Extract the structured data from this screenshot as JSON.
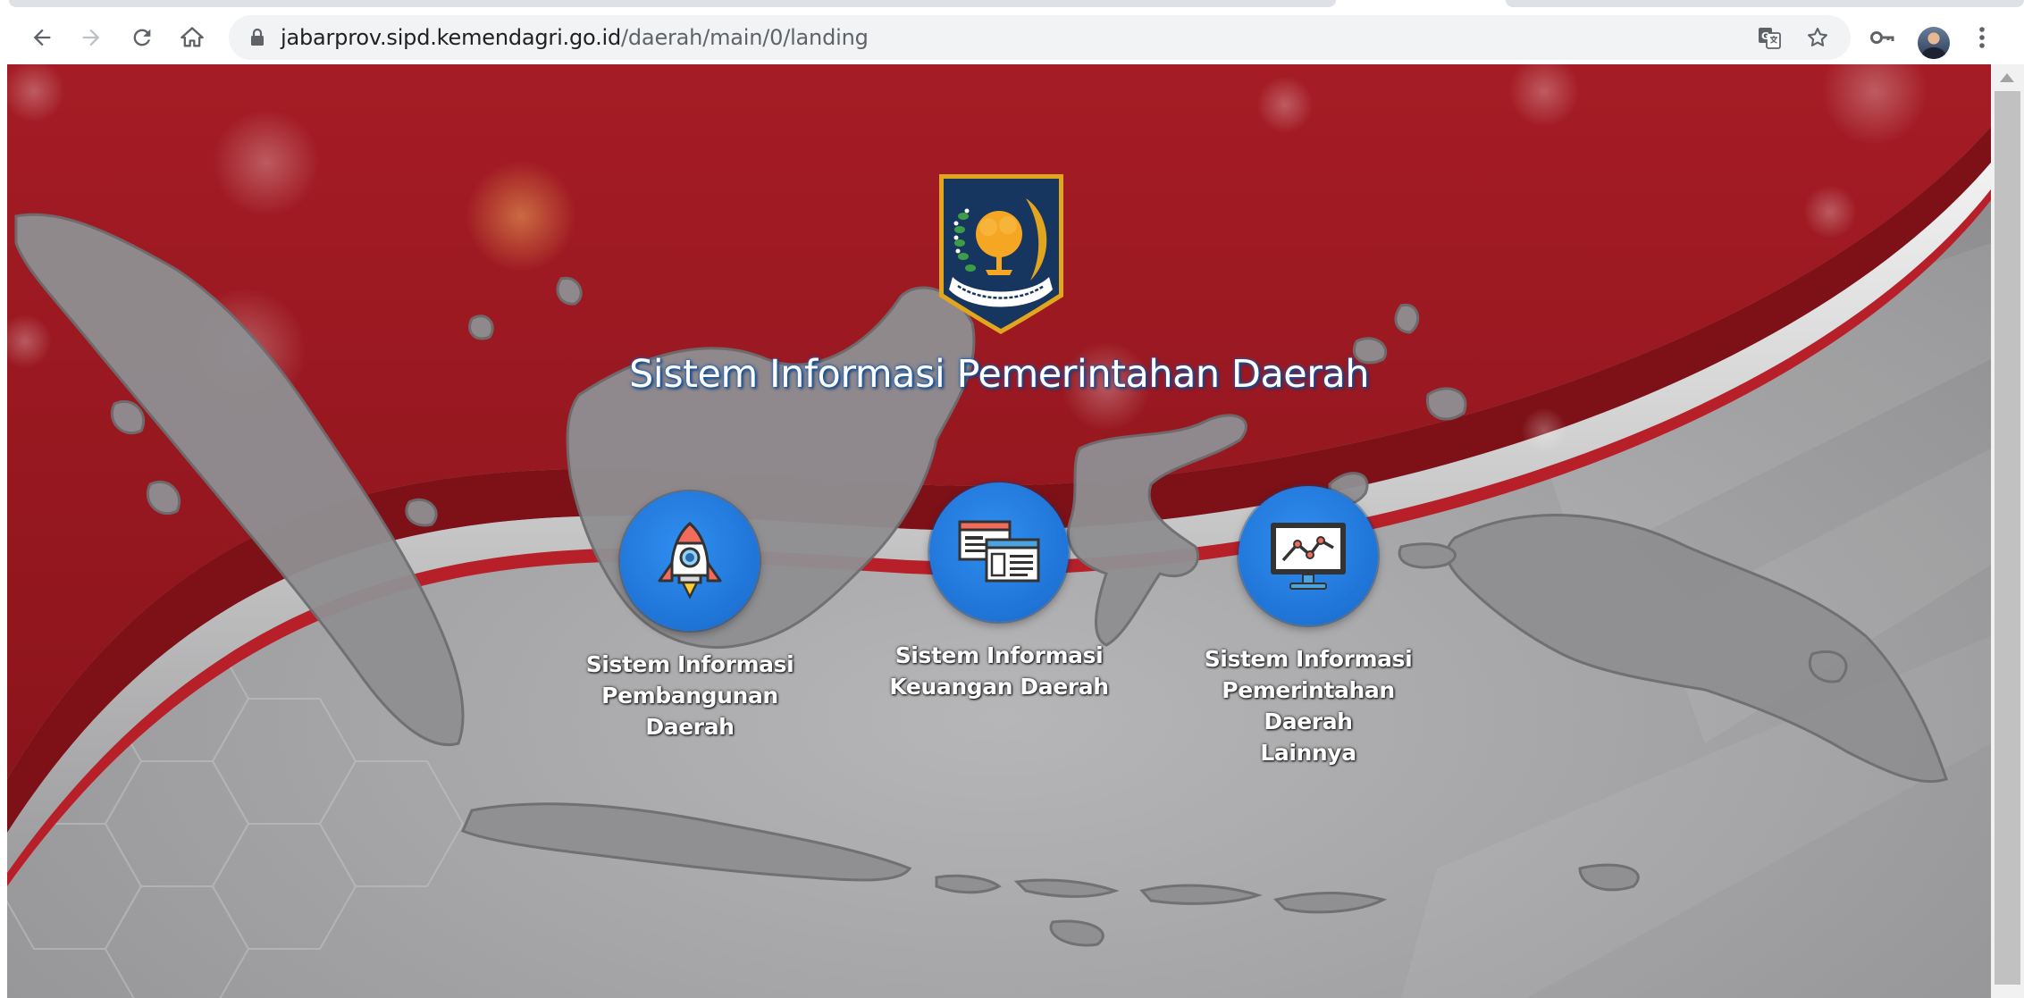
{
  "browser": {
    "url_host": "jabarprov.sipd.kemendagri.go.id",
    "url_path": "/daerah/main/0/landing"
  },
  "page": {
    "title": "Sistem Informasi Pemerintahan Daerah",
    "menu": [
      {
        "icon": "rocket-icon",
        "label_line1": "Sistem Informasi",
        "label_line2": "Pembangunan Daerah",
        "label_line3": ""
      },
      {
        "icon": "windows-icon",
        "label_line1": "Sistem Informasi",
        "label_line2": "Keuangan Daerah",
        "label_line3": ""
      },
      {
        "icon": "monitor-chart-icon",
        "label_line1": "Sistem Informasi",
        "label_line2": "Pemerintahan Daerah",
        "label_line3": "Lainnya"
      }
    ]
  },
  "colors": {
    "red": "#9b1a22",
    "gray": "#9a9a9c",
    "circle_blue": "#1f74d6",
    "title_glow": "#1a5fb4"
  }
}
